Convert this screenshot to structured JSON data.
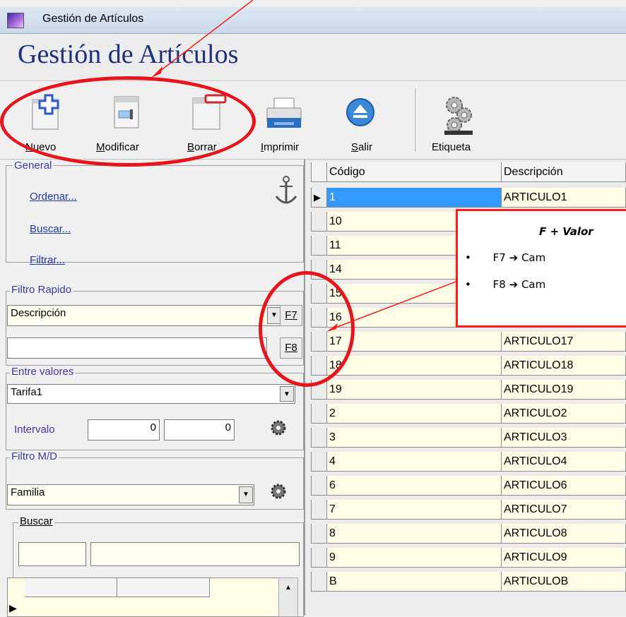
{
  "window": {
    "title": "Gestión de Artículos"
  },
  "header": {
    "title": "Gestión de Artículos"
  },
  "toolbar": {
    "nuevo": {
      "first": "N",
      "rest": "uevo"
    },
    "modificar": {
      "first": "M",
      "rest": "odificar"
    },
    "borrar": {
      "first": "B",
      "rest": "orrar"
    },
    "imprimir": {
      "first": "I",
      "rest": "mprimir"
    },
    "salir": {
      "first": "S",
      "rest": "alir"
    },
    "etiqueta": "Etiqueta"
  },
  "general": {
    "label": "General",
    "ordenar": "Ordenar...",
    "buscar": "Buscar...",
    "filtrar": "Filtrar..."
  },
  "filtro_rapido": {
    "label": "Filtro Rapido",
    "field": "Descripción",
    "f7": "F7",
    "f8": "F8",
    "value": ""
  },
  "entre_valores": {
    "label": "Entre valores",
    "tarifa": "Tarifa1",
    "intervalo": "Intervalo",
    "desde": "0",
    "hasta": "0"
  },
  "filtro_md": {
    "label": "Filtro M/D",
    "familia": "Familia"
  },
  "buscar": {
    "label": "Buscar"
  },
  "grid": {
    "headers": {
      "codigo": "Código",
      "descripcion": "Descripción"
    },
    "rows": [
      {
        "codigo": "1",
        "desc": "ARTICULO1"
      },
      {
        "codigo": "10",
        "desc": ""
      },
      {
        "codigo": "11",
        "desc": ""
      },
      {
        "codigo": "14",
        "desc": ""
      },
      {
        "codigo": "15",
        "desc": ""
      },
      {
        "codigo": "16",
        "desc": ""
      },
      {
        "codigo": "17",
        "desc": "ARTICULO17"
      },
      {
        "codigo": "18",
        "desc": "ARTICULO18"
      },
      {
        "codigo": "19",
        "desc": "ARTICULO19"
      },
      {
        "codigo": "2",
        "desc": "ARTICULO2"
      },
      {
        "codigo": "3",
        "desc": "ARTICULO3"
      },
      {
        "codigo": "4",
        "desc": "ARTICULO4"
      },
      {
        "codigo": "6",
        "desc": "ARTICULO6"
      },
      {
        "codigo": "7",
        "desc": "ARTICULO7"
      },
      {
        "codigo": "8",
        "desc": "ARTICULO8"
      },
      {
        "codigo": "9",
        "desc": "ARTICULO9"
      },
      {
        "codigo": "B",
        "desc": "ARTICULOB"
      }
    ]
  },
  "tooltip": {
    "title": "F + Valor",
    "line1_key": "F7",
    "line1_text": "Cam",
    "line2_key": "F8",
    "line2_text": "Cam"
  },
  "colors": {
    "annotation_red": "#e8141c",
    "selected_row": "#3399ff",
    "cell_bg": "#fffde6"
  }
}
